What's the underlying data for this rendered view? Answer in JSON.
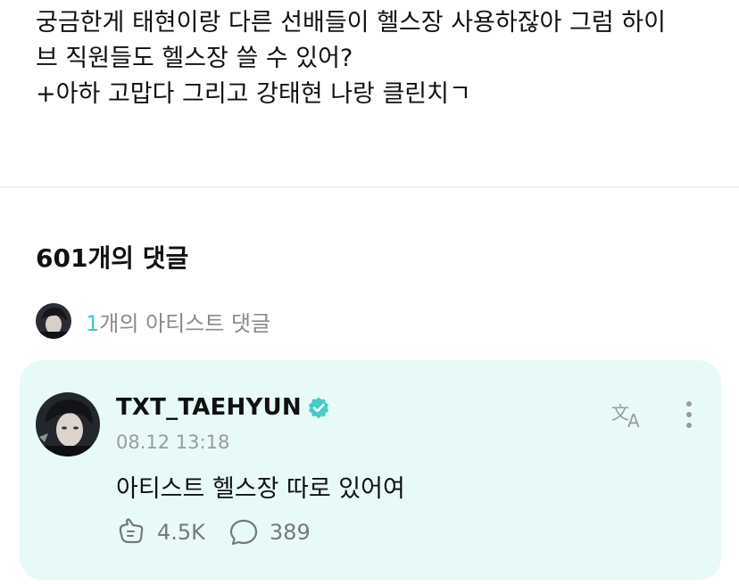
{
  "post": {
    "lines": [
      "궁금한게 태현이랑 다른 선배들이 헬스장 사용하잖아 그럼 하이",
      "브 직원들도 헬스장 쓸 수 있어?",
      "+아하 고맙다 그리고 강태현 나랑 클린치ㄱ"
    ]
  },
  "comments": {
    "count_label": "601개의 댓글",
    "artist_count": "1",
    "artist_label_suffix": "개의 아티스트 댓글"
  },
  "artist_comment": {
    "username": "TXT_TAEHYUN",
    "timestamp": "08.12 13:18",
    "text": "아티스트 헬스장 따로 있어여",
    "likes": "4.5K",
    "replies": "389"
  },
  "icons": {
    "verified": "verified-badge-icon",
    "translate": "translate-icon",
    "more": "more-vertical-icon",
    "like": "like-hand-icon",
    "reply": "comment-bubble-icon"
  },
  "colors": {
    "accent": "#3fc9c7",
    "card_background": "#e8faf8",
    "muted_text": "#8a8a8f"
  }
}
